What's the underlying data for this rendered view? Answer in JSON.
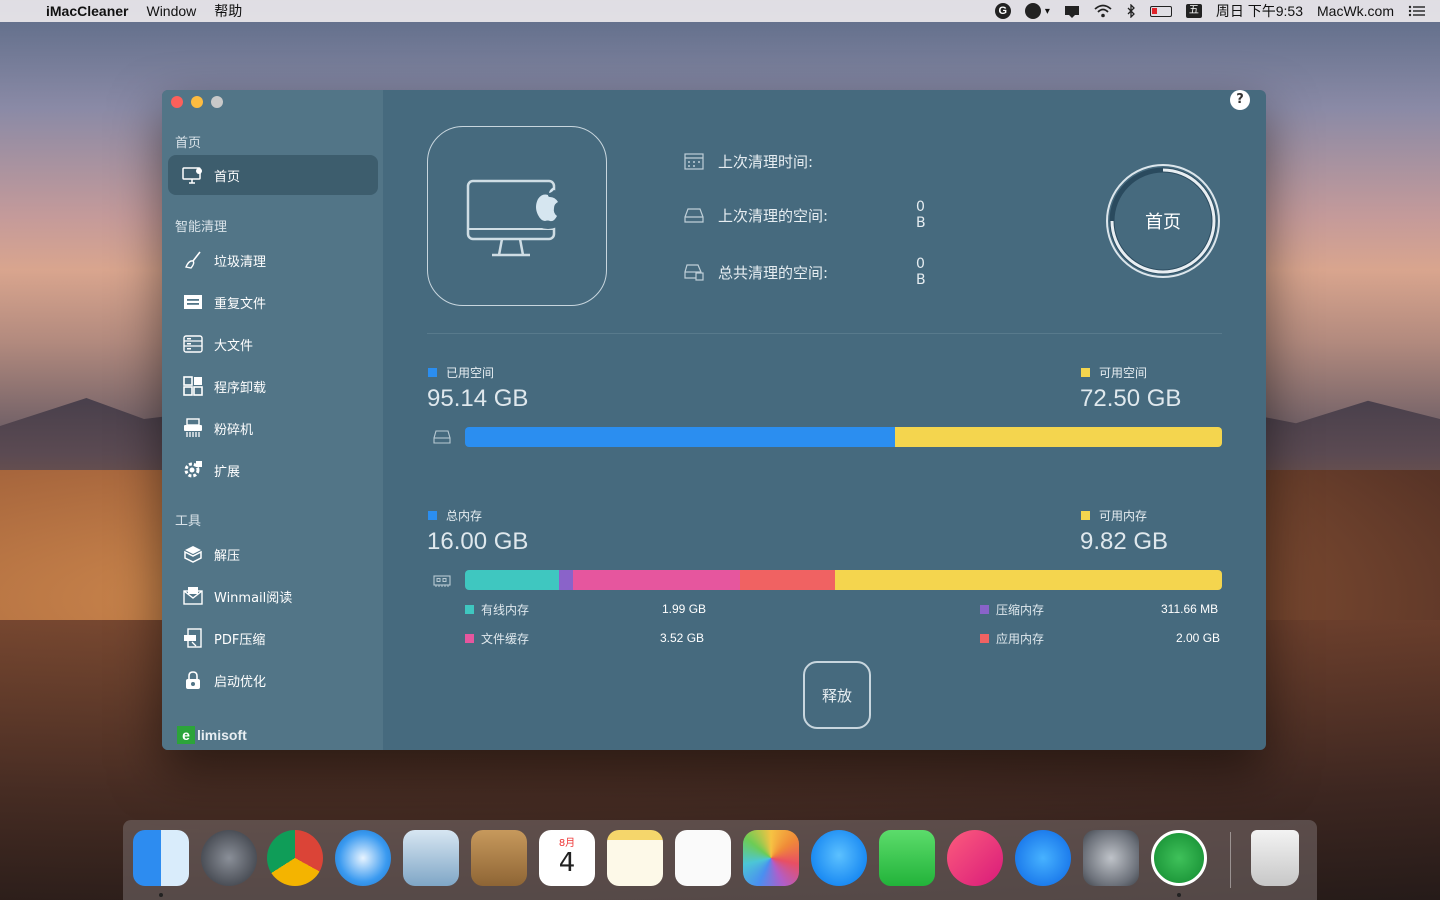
{
  "menubar": {
    "app_name": "iMacCleaner",
    "menus": [
      "Window",
      "帮助"
    ],
    "clock": "周日 下午9:53",
    "site": "MacWk.com",
    "tray_icons": [
      "grammarly-icon",
      "dot-icon",
      "chevron-down-icon",
      "notification-icon",
      "wifi-icon",
      "bluetooth-icon",
      "battery-icon",
      "input-method-icon",
      "list-icon"
    ],
    "tray_g": "G",
    "tray_ime": "五"
  },
  "sidebar": {
    "section_home": "首页",
    "item_home": "首页",
    "section_smart": "智能清理",
    "item_junk": "垃圾清理",
    "item_dupes": "重复文件",
    "item_large": "大文件",
    "item_uninstall": "程序卸载",
    "item_shredder": "粉碎机",
    "item_ext": "扩展",
    "section_tools": "工具",
    "item_unzip": "解压",
    "item_winmail": "Winmail阅读",
    "item_pdf": "PDF压缩",
    "item_startup": "启动优化",
    "logo_e": "e",
    "logo_text": "limisoft"
  },
  "main": {
    "help": "?",
    "last_clean_time_label": "上次清理时间:",
    "last_clean_space_label": "上次清理的空间:",
    "last_clean_space_value": "0 B",
    "total_clean_label": "总共清理的空间:",
    "total_clean_value": "0 B",
    "ring_label": "首页",
    "used_label": "已用空间",
    "used_value": "95.14 GB",
    "free_label": "可用空间",
    "free_value": "72.50 GB",
    "disk_used_fraction": 0.568,
    "total_mem_label": "总内存",
    "total_mem_value": "16.00 GB",
    "avail_mem_label": "可用内存",
    "avail_mem_value": "9.82 GB",
    "wired_label": "有线内存",
    "wired_value": "1.99 GB",
    "compressed_label": "压缩内存",
    "compressed_value": "311.66 MB",
    "file_cache_label": "文件缓存",
    "file_cache_value": "3.52 GB",
    "app_mem_label": "应用内存",
    "app_mem_value": "2.00 GB",
    "release_label": "释放"
  },
  "colors": {
    "used": "#2b8ef0",
    "free": "#f4d54e",
    "wired": "#3fc7c0",
    "compressed": "#8a63c9",
    "file_cache": "#e6569e",
    "app_mem": "#f06262"
  },
  "dock": {
    "apps": [
      "finder-icon",
      "launchpad-icon",
      "chrome-icon",
      "safari-icon",
      "mail-icon",
      "contacts-icon",
      "calendar-icon",
      "notes-icon",
      "reminders-icon",
      "photos-icon",
      "messages-icon",
      "facetime-icon",
      "music-icon",
      "app-store-icon",
      "system-preferences-icon",
      "imaccleaner-icon",
      "trash-icon"
    ],
    "calendar_month": "8月",
    "calendar_day": "4"
  }
}
